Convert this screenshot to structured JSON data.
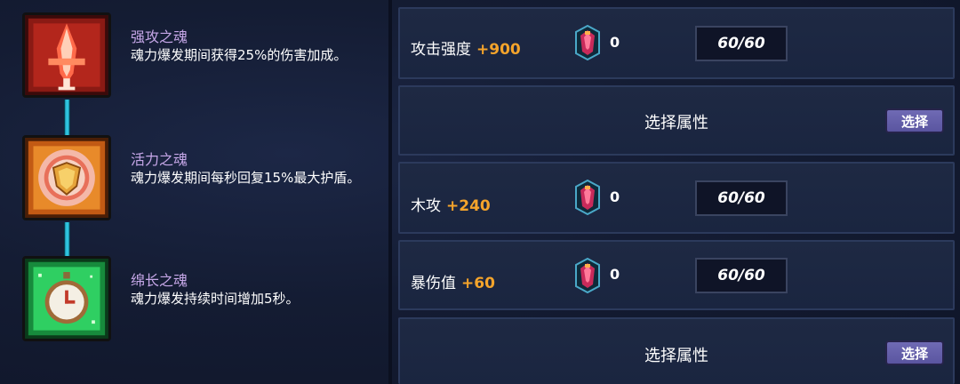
{
  "skills": [
    {
      "name": "强攻之魂",
      "desc": "魂力爆发期间获得25%的伤害加成。",
      "icon": "attack-soul-icon"
    },
    {
      "name": "活力之魂",
      "desc": "魂力爆发期间每秒回复15%最大护盾。",
      "icon": "vitality-soul-icon"
    },
    {
      "name": "绵长之魂",
      "desc": "魂力爆发持续时间增加5秒。",
      "icon": "duration-soul-icon"
    }
  ],
  "attributes": [
    {
      "type": "stat",
      "label": "攻击强度",
      "bonus": "+900",
      "gem_count": "0",
      "progress": "60/60"
    },
    {
      "type": "select",
      "text": "选择属性",
      "button": "选择"
    },
    {
      "type": "stat",
      "label": "木攻",
      "bonus": "+240",
      "gem_count": "0",
      "progress": "60/60"
    },
    {
      "type": "stat",
      "label": "暴伤值",
      "bonus": "+60",
      "gem_count": "0",
      "progress": "60/60"
    },
    {
      "type": "select",
      "text": "选择属性",
      "button": "选择"
    }
  ],
  "colors": {
    "bonus": "#f5a42b",
    "skill_name": "#c6a7e8",
    "connector": "#35d6f0",
    "button": "#6f6ab4"
  }
}
